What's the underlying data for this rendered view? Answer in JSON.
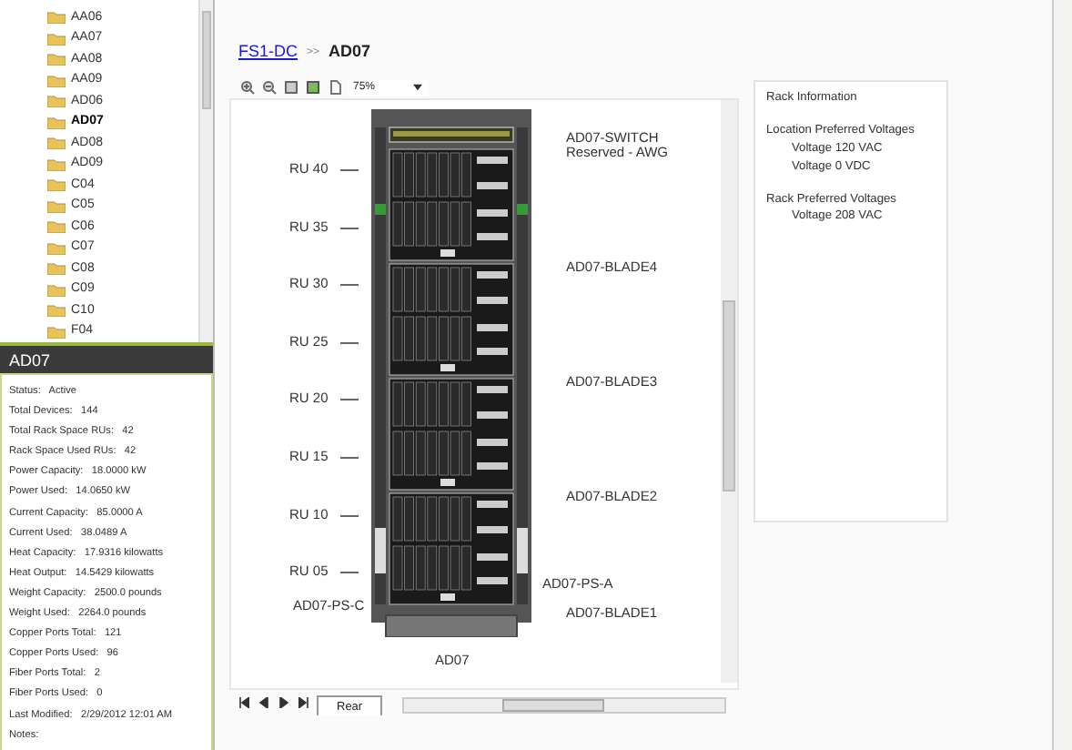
{
  "tree": {
    "items": [
      {
        "label": "AA06",
        "selected": false
      },
      {
        "label": "AA07",
        "selected": false
      },
      {
        "label": "AA08",
        "selected": false
      },
      {
        "label": "AA09",
        "selected": false
      },
      {
        "label": "AD06",
        "selected": false
      },
      {
        "label": "AD07",
        "selected": true
      },
      {
        "label": "AD08",
        "selected": false
      },
      {
        "label": "AD09",
        "selected": false
      },
      {
        "label": "C04",
        "selected": false
      },
      {
        "label": "C05",
        "selected": false
      },
      {
        "label": "C06",
        "selected": false
      },
      {
        "label": "C07",
        "selected": false
      },
      {
        "label": "C08",
        "selected": false
      },
      {
        "label": "C09",
        "selected": false
      },
      {
        "label": "C10",
        "selected": false
      },
      {
        "label": "F04",
        "selected": false
      }
    ]
  },
  "details": {
    "title": "AD07",
    "rows": [
      {
        "label": "Status:",
        "value": "Active"
      },
      {
        "label": "Total Devices:",
        "value": "144"
      },
      {
        "label": "Total Rack Space RUs:",
        "value": "42"
      },
      {
        "label": "Rack Space Used RUs:",
        "value": "42"
      },
      {
        "label": "Power Capacity:",
        "value": "18.0000 kW"
      },
      {
        "label": "Power Used:",
        "value": "14.0650 kW"
      },
      {
        "label": "Current Capacity:",
        "value": "85.0000 A"
      },
      {
        "label": "Current Used:",
        "value": "38.0489 A"
      },
      {
        "label": "Heat Capacity:",
        "value": "17.9316 kilowatts"
      },
      {
        "label": "Heat Output:",
        "value": "14.5429 kilowatts"
      },
      {
        "label": "Weight Capacity:",
        "value": "2500.0 pounds"
      },
      {
        "label": "Weight Used:",
        "value": "2264.0 pounds"
      },
      {
        "label": "Copper Ports Total:",
        "value": "121"
      },
      {
        "label": "Copper Ports Used:",
        "value": "96"
      },
      {
        "label": "Fiber Ports Total:",
        "value": "2"
      },
      {
        "label": "Fiber Ports Used:",
        "value": "0"
      },
      {
        "label": "Last Modified:",
        "value": "2/29/2012 12:01 AM"
      },
      {
        "label": "Notes:",
        "value": ""
      }
    ]
  },
  "breadcrumb": {
    "link": "FS1-DC",
    "separator": ">>",
    "current": "AD07"
  },
  "toolbar": {
    "zoom": "75%"
  },
  "rack": {
    "ru_labels": [
      "RU 40",
      "RU 35",
      "RU 30",
      "RU 25",
      "RU 20",
      "RU 15",
      "RU 10",
      "RU 05"
    ],
    "devices": [
      {
        "lines": [
          "AD07-SWITCH",
          "Reserved - AWG"
        ]
      },
      {
        "lines": [
          "AD07-BLADE4"
        ]
      },
      {
        "lines": [
          "AD07-BLADE3"
        ]
      },
      {
        "lines": [
          "AD07-BLADE2"
        ]
      },
      {
        "lines": [
          "AD07-PS-A"
        ]
      },
      {
        "lines": [
          "AD07-PS-C"
        ]
      },
      {
        "lines": [
          "AD07-BLADE1"
        ]
      }
    ],
    "name": "AD07"
  },
  "rack_info": {
    "title": "Rack Information",
    "groups": [
      {
        "heading": "Location Preferred Voltages",
        "lines": [
          "Voltage 120 VAC",
          "Voltage 0 VDC"
        ]
      },
      {
        "heading": "Rack Preferred Voltages",
        "lines": [
          "Voltage 208 VAC"
        ]
      }
    ]
  },
  "sheet_tabs": [
    {
      "label": "Rear",
      "selected": true
    }
  ]
}
